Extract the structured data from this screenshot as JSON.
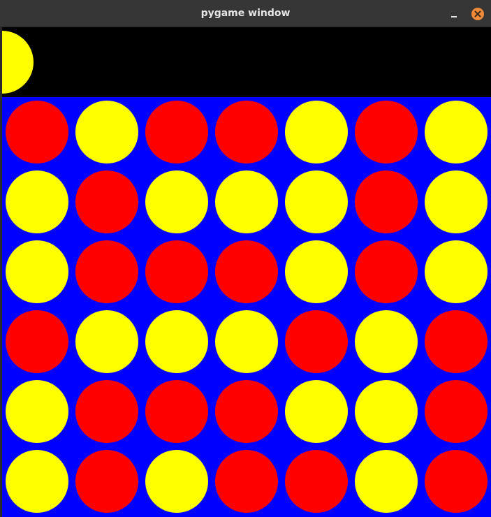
{
  "window": {
    "title": "pygame window"
  },
  "colors": {
    "red": "#ff0000",
    "yellow": "#ffff00",
    "board": "#0000ff",
    "empty": "#000000"
  },
  "game": {
    "hover_piece": "yellow",
    "hover_column": 0,
    "rows": 6,
    "cols": 7,
    "board": [
      [
        "red",
        "yellow",
        "red",
        "red",
        "yellow",
        "red",
        "yellow"
      ],
      [
        "yellow",
        "red",
        "yellow",
        "yellow",
        "yellow",
        "red",
        "yellow"
      ],
      [
        "yellow",
        "red",
        "red",
        "red",
        "yellow",
        "red",
        "yellow"
      ],
      [
        "red",
        "yellow",
        "yellow",
        "yellow",
        "red",
        "yellow",
        "red"
      ],
      [
        "yellow",
        "red",
        "red",
        "red",
        "yellow",
        "yellow",
        "red"
      ],
      [
        "yellow",
        "red",
        "yellow",
        "red",
        "red",
        "yellow",
        "red"
      ]
    ]
  }
}
